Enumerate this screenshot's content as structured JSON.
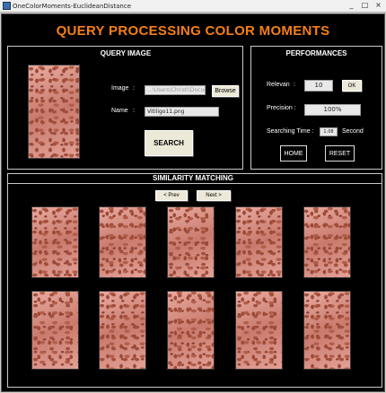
{
  "window": {
    "title": "OneColorMoments-EuclideanDistance",
    "minimize": "_",
    "maximize": "□",
    "close": "×"
  },
  "header": {
    "title": "QUERY PROCESSING COLOR MOMENTS"
  },
  "query": {
    "title": "QUERY IMAGE",
    "image_label": "Image",
    "image_colon": ":",
    "image_path": "...\\Users\\Christi\\Documents\\",
    "browse_label": "Browse",
    "name_label": "Name",
    "name_colon": ":",
    "name_value": "Vitiligo11.png",
    "search_label": "SEARCH"
  },
  "performance": {
    "title": "PERFORMANCES",
    "relevan_label": "Relevan",
    "relevan_colon": ":",
    "relevan_value": "10",
    "ok_label": "OK",
    "precision_label": "Precision :",
    "precision_value": "100%",
    "searching_label": "Searching Time :",
    "searching_value": "1.08",
    "searching_unit": "Second",
    "home_label": "HOME",
    "reset_label": "RESET"
  },
  "similarity": {
    "title": "SIMILARITY MATCHING",
    "prev_label": "< Prev",
    "next_label": "Next >"
  }
}
